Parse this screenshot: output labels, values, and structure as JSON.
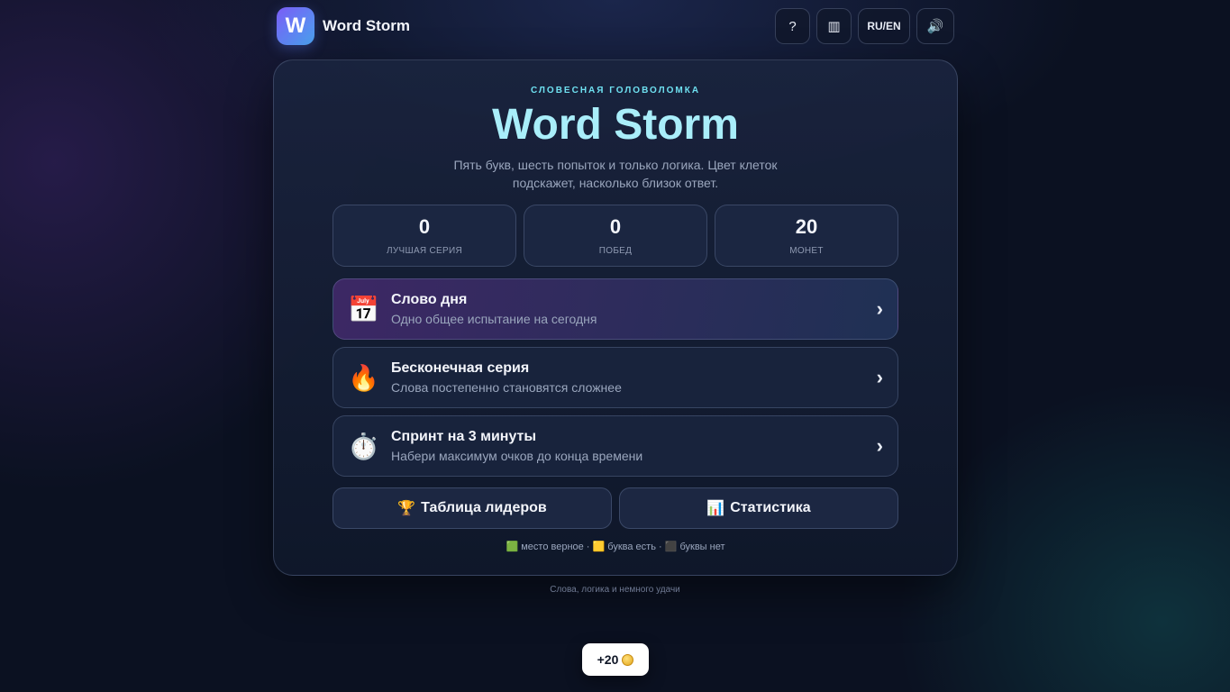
{
  "header": {
    "logo_letter": "W",
    "app_name": "Word Storm",
    "help_label": "?",
    "menu_label": "▥",
    "lang_label": "RU/EN",
    "sound_label": "🔊"
  },
  "hero": {
    "eyebrow": "СЛОВЕСНАЯ ГОЛОВОЛОМКА",
    "title": "Word Storm",
    "subtitle": "Пять букв, шесть попыток и только логика. Цвет клеток подскажет, насколько близок ответ."
  },
  "stats": [
    {
      "value": "0",
      "label": "ЛУЧШАЯ СЕРИЯ"
    },
    {
      "value": "0",
      "label": "ПОБЕД"
    },
    {
      "value": "20",
      "label": "МОНЕТ"
    }
  ],
  "modes": [
    {
      "icon": "📅",
      "title": "Слово дня",
      "desc": "Одно общее испытание на сегодня"
    },
    {
      "icon": "🔥",
      "title": "Бесконечная серия",
      "desc": "Слова постепенно становятся сложнее"
    },
    {
      "icon": "⏱️",
      "title": "Спринт на 3 минуты",
      "desc": "Набери максимум очков до конца времени"
    }
  ],
  "chevron": "›",
  "actions": {
    "leaderboard_icon": "🏆",
    "leaderboard_label": "Таблица лидеров",
    "stats_icon": "📊",
    "stats_label": "Статистика"
  },
  "legend": "🟩 место верное · 🟨 буква есть · ⬛ буквы нет",
  "footer": "Слова, логика и немного удачи",
  "toast": {
    "text": "+20"
  },
  "colors": {
    "accent_cyan": "#6ee0f0",
    "title": "#a9eefa",
    "background": "#0b1121"
  }
}
